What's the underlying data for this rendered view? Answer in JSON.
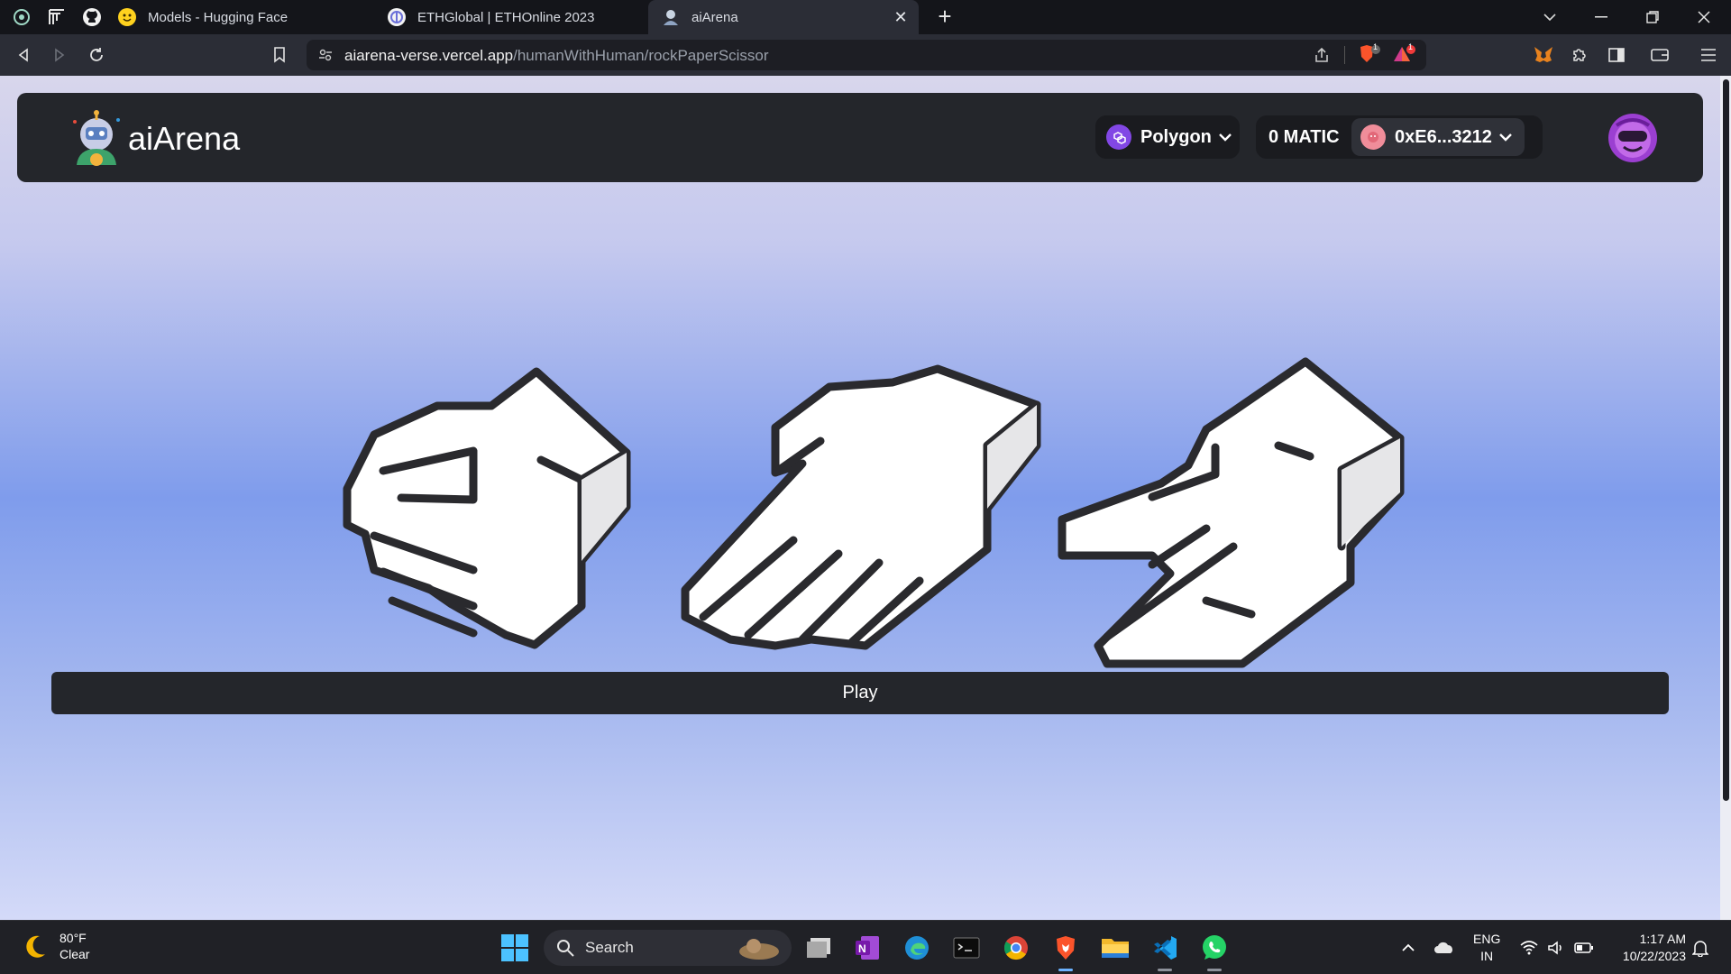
{
  "browser": {
    "tabs": [
      {
        "title": "Models - Hugging Face",
        "active": false
      },
      {
        "title": "ETHGlobal | ETHOnline 2023",
        "active": false
      },
      {
        "title": "aiArena",
        "active": true
      }
    ],
    "url_domain": "aiarena-verse.vercel.app",
    "url_path": "/humanWithHuman/rockPaperScissor",
    "brave_shield_count": "1",
    "brave_rewards_count": "1"
  },
  "app": {
    "brand": "aiArena",
    "network": "Polygon",
    "balance": "0 MATIC",
    "account": "0xE6...3212",
    "choices": [
      "rock-hand",
      "paper-hand",
      "scissors-hand"
    ],
    "play_label": "Play"
  },
  "taskbar": {
    "weather_temp": "80°F",
    "weather_desc": "Clear",
    "search_placeholder": "Search",
    "lang_line1": "ENG",
    "lang_line2": "IN",
    "time": "1:17 AM",
    "date": "10/22/2023"
  },
  "colors": {
    "header_bg": "#24262b",
    "polygon": "#8247e5",
    "page_gradient_mid": "#7f9cec"
  }
}
